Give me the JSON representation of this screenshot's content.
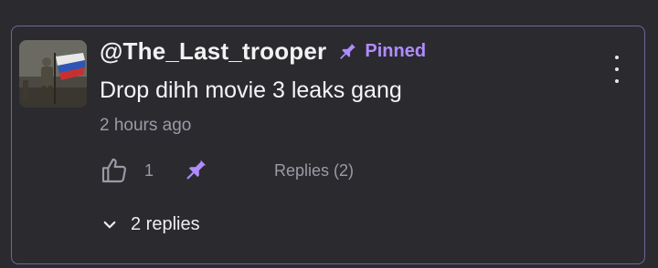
{
  "comment": {
    "author": "@The_Last_trooper",
    "pinned_label": "Pinned",
    "text": "Drop dihh movie 3 leaks gang",
    "timestamp": "2 hours ago",
    "like_count": "1",
    "replies_link": "Replies (2)",
    "expand_replies_label": "2 replies"
  },
  "icons": {
    "avatar": "soldier-with-flag-avatar",
    "pinned": "pushpin-icon",
    "more": "vertical-ellipsis-icon",
    "like": "thumbs-up-icon",
    "pin_action": "pushpin-icon",
    "expand": "chevron-down-icon"
  },
  "colors": {
    "background": "#2b2a2f",
    "card_border": "#6e6896",
    "accent": "#b08cff",
    "text_primary": "#f5f5f5",
    "text_secondary": "#9c9aa5"
  }
}
